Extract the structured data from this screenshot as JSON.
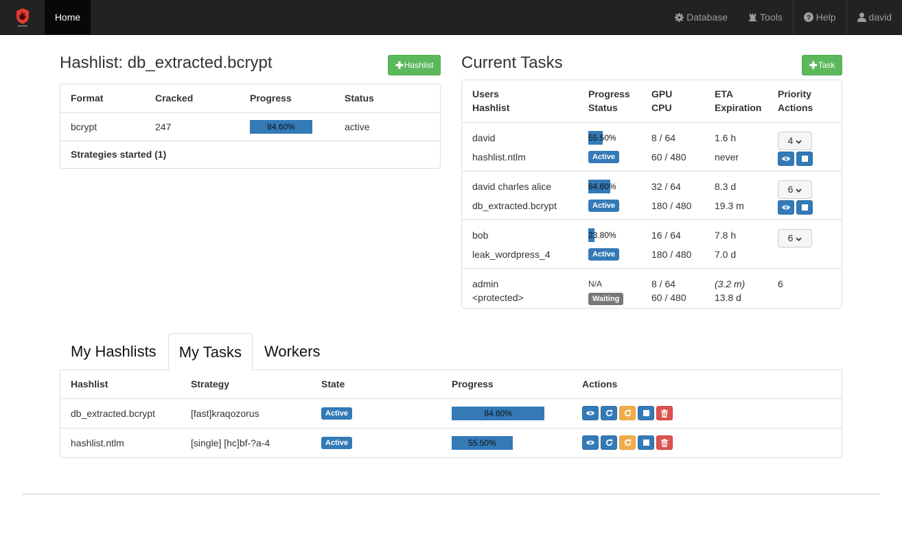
{
  "nav": {
    "home_label": "Home",
    "right_items": [
      {
        "label": "Database",
        "icon": "gear-icon"
      },
      {
        "label": "Tools",
        "icon": "tower-icon"
      },
      {
        "label": "Help",
        "icon": "question-circle-icon"
      },
      {
        "label": "david",
        "icon": "user-icon"
      }
    ],
    "brand_color": "#e53935"
  },
  "hashlist": {
    "title": "Hashlist: db_extracted.bcrypt",
    "add_button": "Hashlist",
    "columns": [
      "Format",
      "Cracked",
      "Progress",
      "Status"
    ],
    "row": {
      "format": "bcrypt",
      "cracked": "247",
      "progress": 84.6,
      "progress_label": "84.60%",
      "status": "active"
    },
    "strategies_label": "Strategies started (1)"
  },
  "current_tasks": {
    "title": "Current Tasks",
    "add_button": "Task",
    "columns": [
      {
        "top": "Users",
        "bottom": "Hashlist"
      },
      {
        "top": "Progress",
        "bottom": "Status"
      },
      {
        "top": "GPU",
        "bottom": "CPU"
      },
      {
        "top": "ETA",
        "bottom": "Expiration"
      },
      {
        "top": "Priority",
        "bottom": "Actions"
      }
    ],
    "rows": [
      {
        "users": "david",
        "hashlist": "hashlist.ntlm",
        "progress": 55.5,
        "progress_label": "55.50%",
        "status": "Active",
        "gpu": "8 / 64",
        "cpu": "60 / 480",
        "eta": "1.6 h",
        "expiration": "never",
        "priority": "4"
      },
      {
        "users": "david charles alice",
        "hashlist": "db_extracted.bcrypt",
        "progress": 84.6,
        "progress_label": "84.60%",
        "status": "Active",
        "gpu": "32 / 64",
        "cpu": "180 / 480",
        "eta": "8.3 d",
        "expiration": "19.3 m",
        "priority": "6"
      },
      {
        "users": "bob",
        "hashlist": "leak_wordpress_4",
        "progress": 23.8,
        "progress_label": "23.80%",
        "status": "Active",
        "gpu": "16 / 64",
        "cpu": "180 / 480",
        "eta": "7.8 h",
        "expiration": "7.0 d",
        "priority": "6"
      },
      {
        "users": "admin",
        "hashlist": "<protected>",
        "progress_label": "N/A",
        "status": "Waiting",
        "gpu": "8 / 64",
        "cpu": "60 / 480",
        "eta": "(3.2 m)",
        "expiration": "13.8 d",
        "priority": "6"
      }
    ]
  },
  "tabs": [
    "My Hashlists",
    "My Tasks",
    "Workers"
  ],
  "active_tab": "My Tasks",
  "my_tasks": {
    "columns": [
      "Hashlist",
      "Strategy",
      "State",
      "Progress",
      "Actions"
    ],
    "rows": [
      {
        "hashlist": "db_extracted.bcrypt",
        "strategy": "[fast]kraqozorus",
        "state": "Active",
        "progress": 84.6,
        "progress_label": "84.60%"
      },
      {
        "hashlist": "hashlist.ntlm",
        "strategy": "[single] [hc]bf-?a-4",
        "state": "Active",
        "progress": 55.5,
        "progress_label": "55.50%"
      }
    ]
  }
}
